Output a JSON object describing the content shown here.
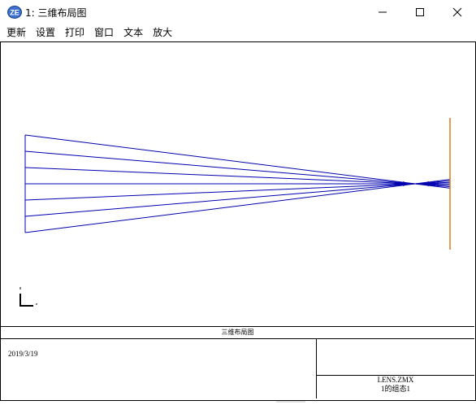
{
  "window": {
    "title": "1: 三维布局图",
    "icon": "zemax-icon"
  },
  "menu": {
    "items": [
      "更新",
      "设置",
      "打印",
      "窗口",
      "文本",
      "放大"
    ]
  },
  "layout_view": {
    "ray_color": "#0000b0",
    "image_plane_color": "#d08020"
  },
  "footer": {
    "caption": "三维布局图",
    "date": "2019/3/19",
    "file": "LENS.ZMX",
    "config": "1的组态1"
  }
}
